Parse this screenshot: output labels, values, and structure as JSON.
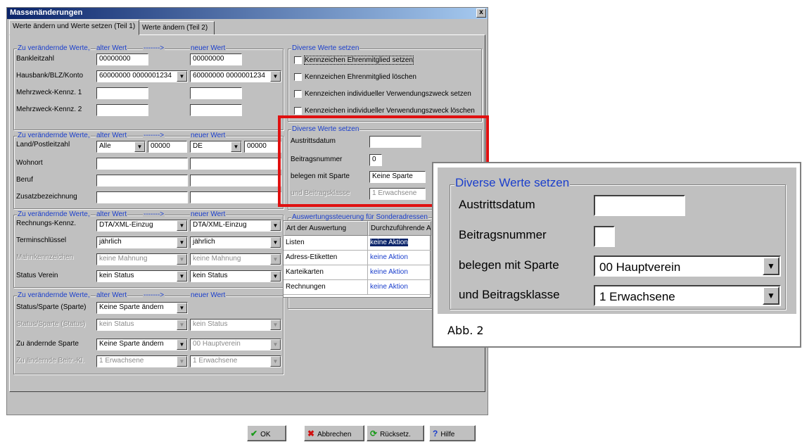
{
  "window": {
    "title": "Massenänderungen",
    "close": "x",
    "tabs": [
      "Werte ändern und Werte setzen (Teil 1)",
      "Werte ändern (Teil 2)"
    ]
  },
  "group1": {
    "label": "Zu verändernde Werte,",
    "old": "alter Wert",
    "arrow": "------->",
    "new": "neuer Wert",
    "rows": [
      {
        "label": "Bankleitzahl",
        "old": "00000000",
        "new": "00000000"
      },
      {
        "label": "Hausbank/BLZ/Konto",
        "old": "60000000  0000001234",
        "new": "60000000  0000001234"
      },
      {
        "label": "Mehrzweck-Kennz. 1",
        "old": "",
        "new": ""
      },
      {
        "label": "Mehrzweck-Kennz. 2",
        "old": "",
        "new": ""
      }
    ]
  },
  "group2": {
    "label": "Zu verändernde Werte,",
    "old": "alter Wert",
    "arrow": "------->",
    "new": "neuer Wert",
    "land_label": "Land/Postleitzahl",
    "land_old": "Alle",
    "plz_old": "00000",
    "land_new": "DE",
    "plz_new": "00000",
    "rows": [
      {
        "label": "Wohnort"
      },
      {
        "label": "Beruf"
      },
      {
        "label": "Zusatzbezeichnung"
      }
    ]
  },
  "group3": {
    "label": "Zu verändernde Werte,",
    "old": "alter Wert",
    "arrow": "------->",
    "new": "neuer Wert",
    "rows": [
      {
        "label": "Rechnungs-Kennz.",
        "old": "DTA/XML-Einzug",
        "new": "DTA/XML-Einzug"
      },
      {
        "label": "Terminschlüssel",
        "old": "jährlich",
        "new": "jährlich"
      },
      {
        "label": "Mahnkennzeichen",
        "old": "keine Mahnung",
        "new": "keine Mahnung"
      },
      {
        "label": "Status Verein",
        "old": "kein Status",
        "new": "kein Status"
      }
    ]
  },
  "group4": {
    "label": "Zu verändernde Werte,",
    "old": "alter Wert",
    "arrow": "------->",
    "new": "neuer Wert",
    "rows": [
      {
        "label": "Status/Sparte (Sparte)",
        "old": "Keine Sparte ändern",
        "new": ""
      },
      {
        "label": "Status/Sparte (Status)",
        "old": "kein Status",
        "new": "kein Status"
      },
      {
        "label": "Zu ändernde Sparte",
        "old": "Keine Sparte ändern",
        "new": "00  Hauptverein"
      },
      {
        "label": "Zu ändernde Beitr.-Kl.",
        "old": "1  Erwachsene",
        "new": "1  Erwachsene"
      }
    ]
  },
  "diverse1": {
    "label": "Diverse Werte setzen",
    "checks": [
      "Kennzeichen Ehrenmitglied setzen",
      "Kennzeichen Ehrenmitglied löschen",
      "Kennzeichen individueller Verwendungszweck setzen",
      "Kennzeichen individueller Verwendungszweck löschen"
    ]
  },
  "diverse2": {
    "label": "Diverse Werte setzen",
    "austritt_label": "Austrittsdatum",
    "austritt_value": "",
    "beitrag_label": "Beitragsnummer",
    "beitrag_value": "0",
    "sparte_label": "belegen mit Sparte",
    "sparte_value": "Keine Sparte",
    "klasse_label": "und Beitragsklasse",
    "klasse_value": "1  Erwachsene"
  },
  "auswertung": {
    "label": "Auswertungssteuerung für Sonderadressen",
    "col1": "Art der Auswertung",
    "col2": "Durchzuführende Aktion",
    "rows": [
      {
        "art": "Listen",
        "aktion": "keine Aktion"
      },
      {
        "art": "Adress-Etiketten",
        "aktion": "keine Aktion"
      },
      {
        "art": "Karteikarten",
        "aktion": "keine Aktion"
      },
      {
        "art": "Rechnungen",
        "aktion": "keine Aktion"
      }
    ]
  },
  "buttons": {
    "ok": "OK",
    "cancel": "Abbrechen",
    "reset": "Rücksetz.",
    "help": "Hilfe"
  },
  "zoom": {
    "label": "Diverse Werte setzen",
    "austritt_label": "Austrittsdatum",
    "beitrag_label": "Beitragsnummer",
    "sparte_label": "belegen mit Sparte",
    "sparte_value": "00  Hauptverein",
    "klasse_label": "und Beitragsklasse",
    "klasse_value": "1  Erwachsene",
    "caption": "Abb. 2"
  }
}
